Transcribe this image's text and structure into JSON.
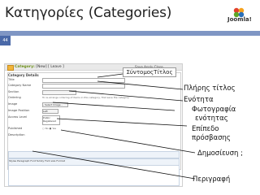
{
  "slide": {
    "title": "Κατηγορίες (Categories)",
    "page_number": "44",
    "logo_text": "Joomla!"
  },
  "screenshot": {
    "header_label": "Category:",
    "header_value": "[New]",
    "header_extra": "[ Leave ]",
    "toolbar_text": "Save  Apply  Close",
    "section_title": "Category Details",
    "labels": [
      "Title",
      "Category Name",
      "Section",
      "Ordering",
      "Image",
      "Image Position",
      "Access Level",
      "Published",
      "Description"
    ],
    "ordering_hint": "To re-arrange ordering of items in this category, first save the category",
    "image_select": "- Select Image -",
    "image_position": "Left",
    "access_options": [
      "Public",
      "Registered",
      "Special"
    ],
    "published_yes": "Yes",
    "published_no": "No",
    "editor_toolbar": "Styles  Paragraph  Font family  Font size  Format"
  },
  "annotations": {
    "alias_box": "ΣύντομοςΤίτλος",
    "full_title": "Πλήρης τίτλος",
    "section": "Ενότητα",
    "photo": "Φωτογραφία",
    "photo_section": "ενότητας",
    "level": "Επίπεδο",
    "access": "πρόσβασης",
    "publish": "Δημοσίευση ;",
    "description": "Περιγραφή"
  },
  "colors": {
    "accent_bar": "#7f96c4",
    "page_badge": "#4a69a8",
    "category_green": "#6a8d16"
  }
}
